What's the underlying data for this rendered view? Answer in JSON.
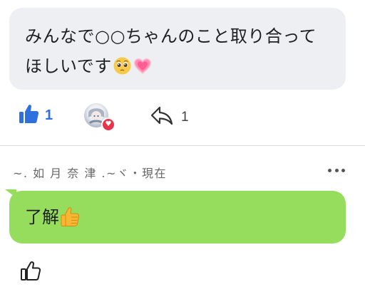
{
  "message1": {
    "text": "みんなで○○ちゃんのこと取り合ってほしいです",
    "emojis": [
      "pleading-face-emoji",
      "pink-heart-emoji"
    ]
  },
  "reactions": {
    "like_count": "1",
    "reactor_badge_icon": "heart-icon",
    "share_count": "1"
  },
  "reply": {
    "author": "~. 如 月 奈 津 .~ヾ",
    "separator": "・",
    "timestamp": "現在",
    "text": "了解",
    "emoji": "thumbs-up-emoji"
  },
  "colors": {
    "accent_blue": "#2f6fe0",
    "bubble_gray": "#eeeff3",
    "bubble_green": "#96dd5d",
    "heart_red": "#e8344a"
  }
}
